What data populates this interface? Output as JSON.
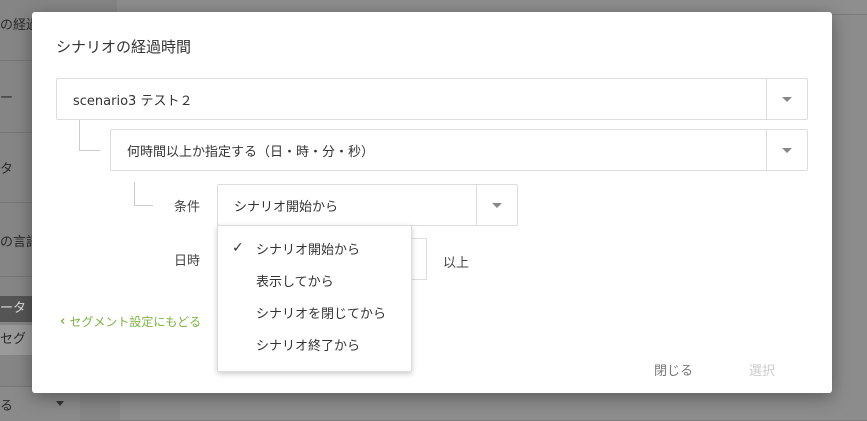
{
  "background": {
    "fragments": [
      "の経過",
      "ー",
      "タ",
      "の言語",
      "ータ",
      "セグ",
      "る"
    ]
  },
  "modal": {
    "title": "シナリオの経過時間",
    "scenario_select": {
      "value": "scenario3 テスト２"
    },
    "time_select": {
      "value": "何時間以上か指定する（日・時・分・秒）"
    },
    "condition": {
      "label": "条件",
      "value": "シナリオ開始から",
      "options": [
        {
          "label": "シナリオ開始から",
          "selected": true
        },
        {
          "label": "表示してから",
          "selected": false
        },
        {
          "label": "シナリオを閉じてから",
          "selected": false
        },
        {
          "label": "シナリオ終了から",
          "selected": false
        }
      ]
    },
    "datetime": {
      "label": "日時",
      "suffix": "以上"
    },
    "back_link": "セグメント設定にもどる",
    "buttons": {
      "close": "閉じる",
      "select": "選択"
    },
    "colors": {
      "link": "#7cb342",
      "disabled": "#cccccc"
    }
  }
}
